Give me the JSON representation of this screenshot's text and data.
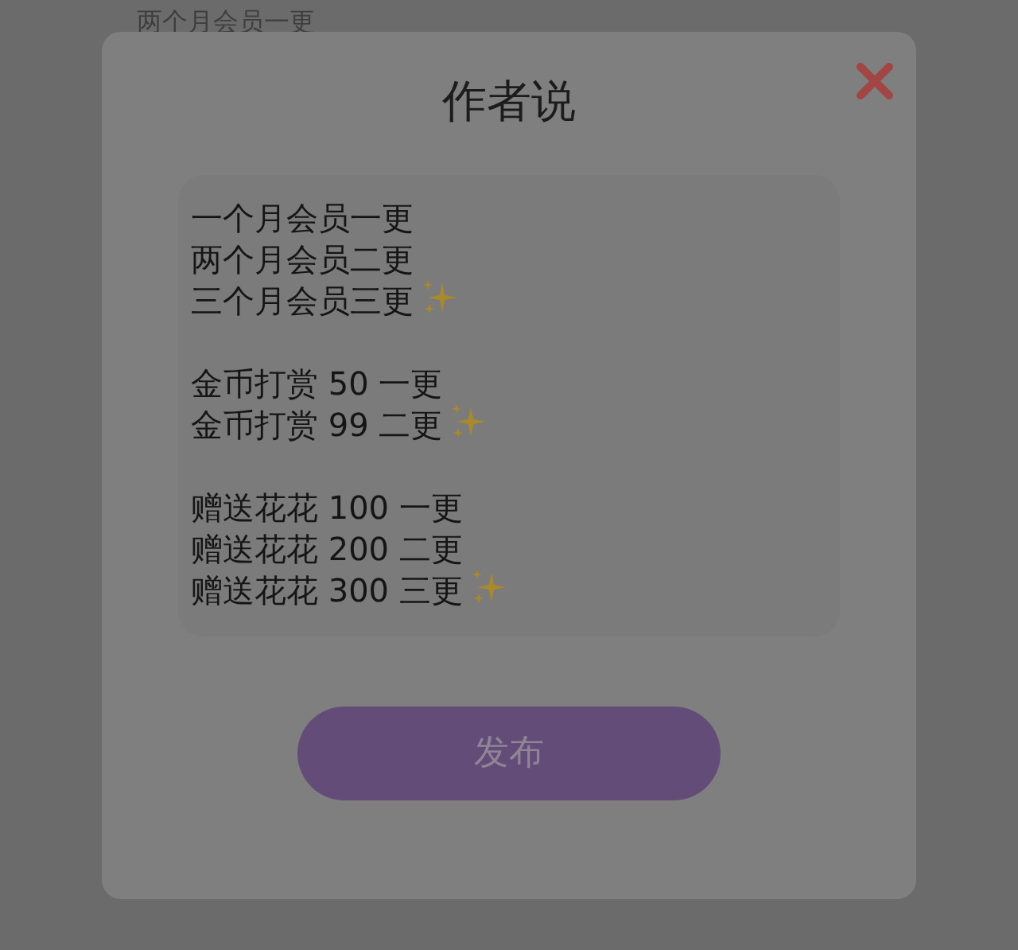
{
  "background_text": "两个月会员一更",
  "dialog": {
    "title": "作者说",
    "groups": [
      [
        {
          "text": "一个月会员一更",
          "sparkle": false
        },
        {
          "text": "两个月会员二更",
          "sparkle": false
        },
        {
          "text": "三个月会员三更",
          "sparkle": true
        }
      ],
      [
        {
          "text": "金币打赏 50 一更",
          "sparkle": false
        },
        {
          "text": "金币打赏 99 二更",
          "sparkle": true
        }
      ],
      [
        {
          "text": "赠送花花 100 一更",
          "sparkle": false
        },
        {
          "text": "赠送花花 200 二更",
          "sparkle": false
        },
        {
          "text": "赠送花花 300 三更",
          "sparkle": true
        }
      ]
    ],
    "button": "发布"
  }
}
